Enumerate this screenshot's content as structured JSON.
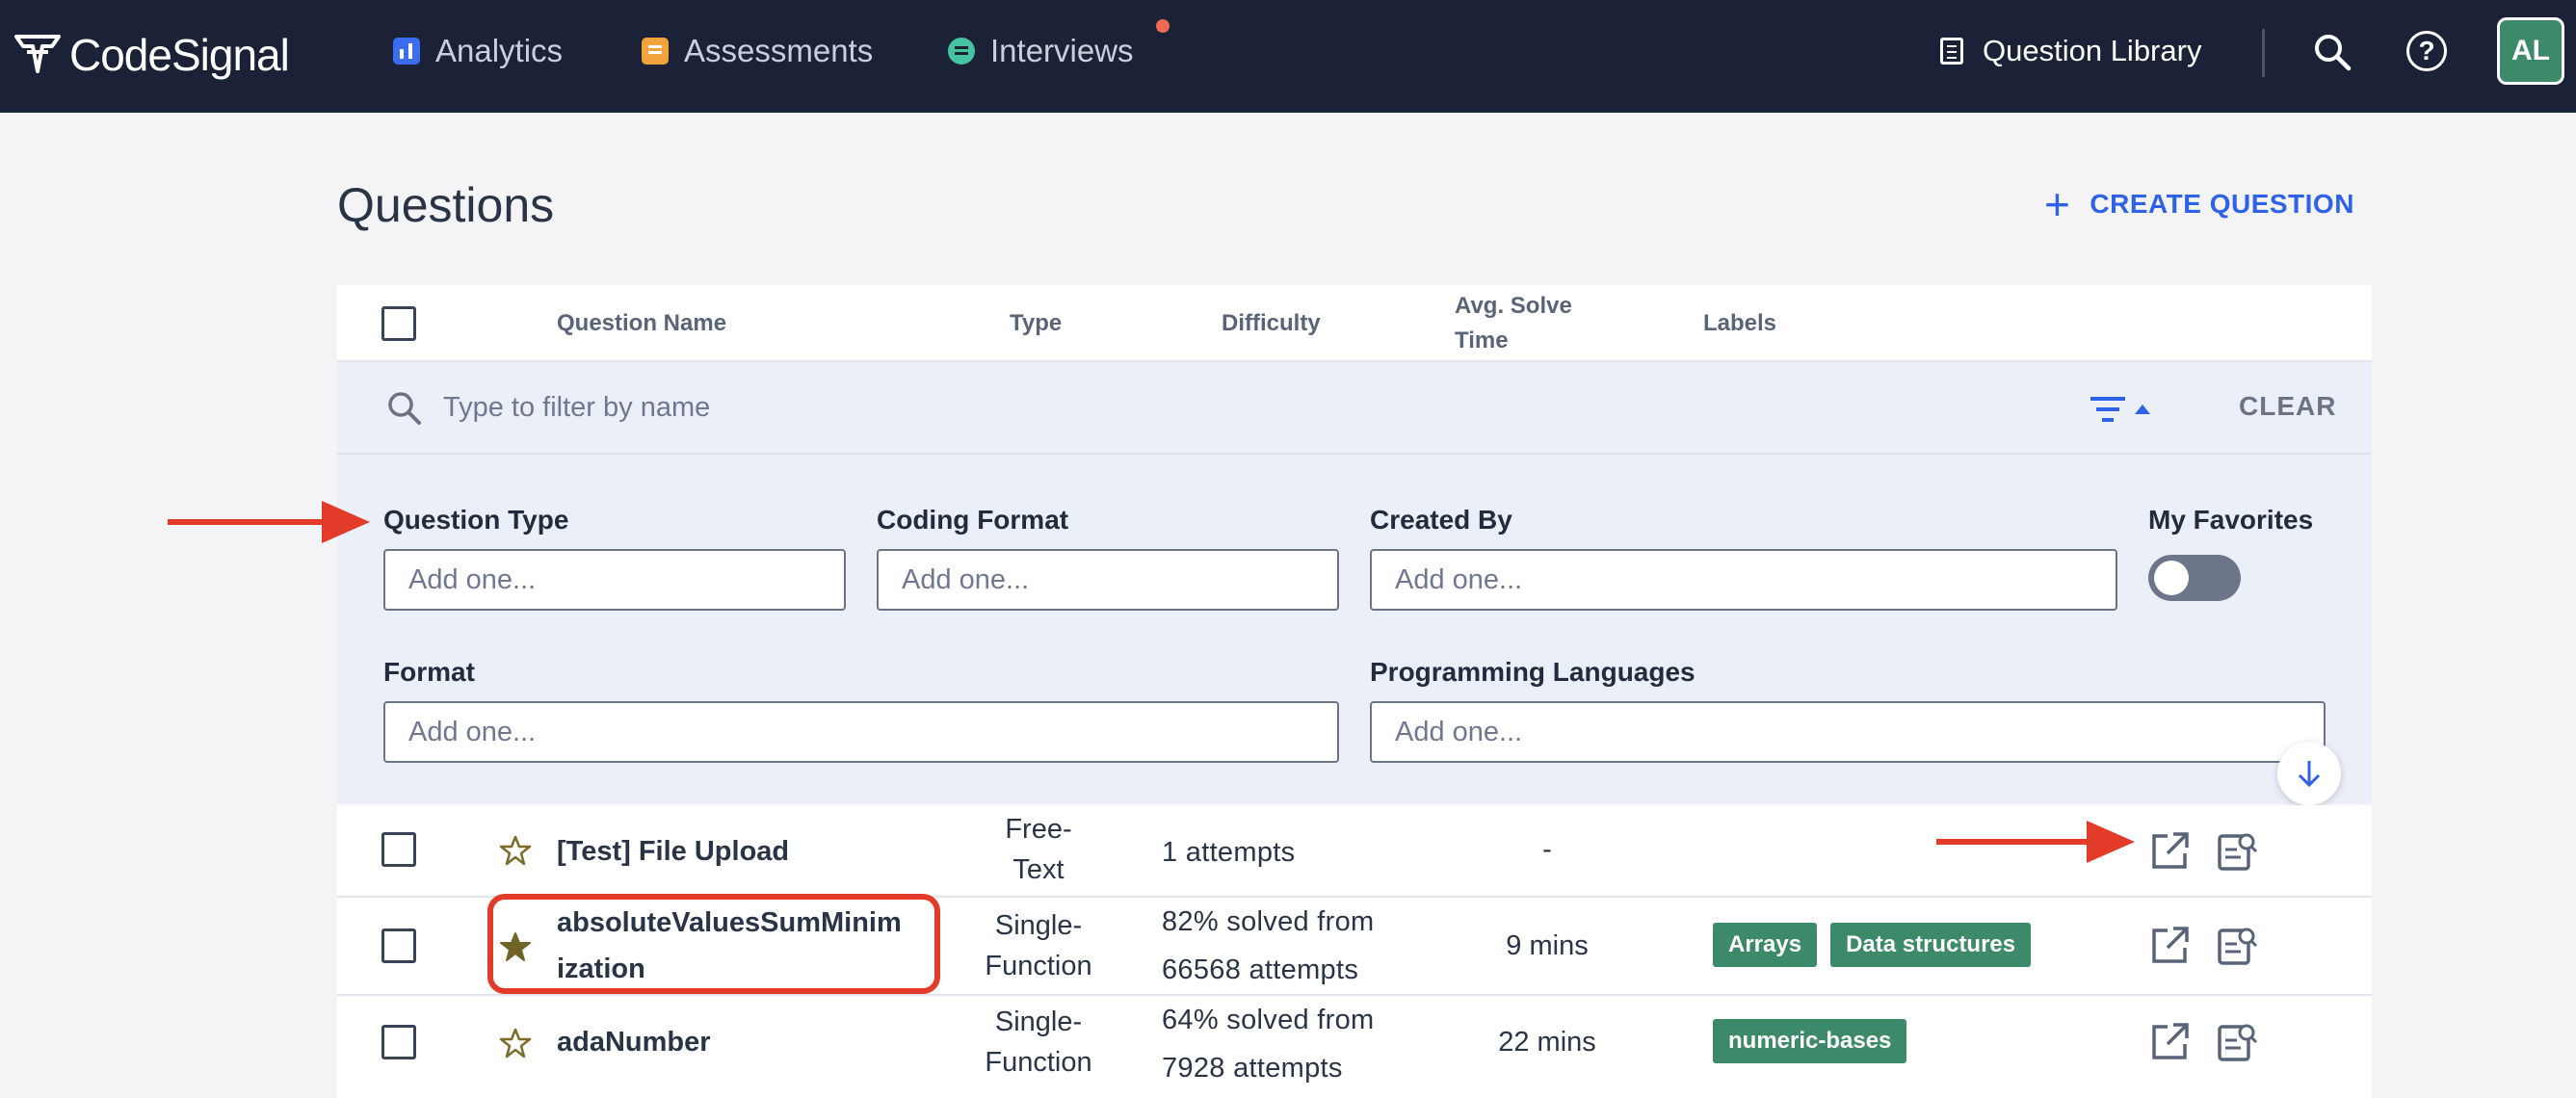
{
  "brand": {
    "name": "CodeSignal"
  },
  "nav": {
    "analytics": "Analytics",
    "assessments": "Assessments",
    "interviews": "Interviews",
    "question_library": "Question Library",
    "avatar_initials": "AL"
  },
  "page": {
    "title": "Questions",
    "create_label": "CREATE QUESTION"
  },
  "table_headers": {
    "name": "Question Name",
    "type": "Type",
    "difficulty": "Difficulty",
    "avg_solve_1": "Avg. Solve",
    "avg_solve_2": "Time",
    "labels": "Labels"
  },
  "filters": {
    "search_placeholder": "Type to filter by name",
    "clear_label": "CLEAR",
    "question_type_label": "Question Type",
    "coding_format_label": "Coding Format",
    "created_by_label": "Created By",
    "my_favorites_label": "My Favorites",
    "format_label": "Format",
    "programming_languages_label": "Programming Languages",
    "add_placeholder": "Add one...",
    "my_favorites_on": false
  },
  "rows": [
    {
      "name": "[Test] File Upload",
      "favorite": false,
      "type_1": "Free-",
      "type_2": "Text",
      "difficulty_1": "1 attempts",
      "difficulty_2": "",
      "avg_time": "-",
      "labels": []
    },
    {
      "name_1": "absoluteValuesSumMinim",
      "name_2": "ization",
      "favorite": true,
      "type_1": "Single-",
      "type_2": "Function",
      "difficulty_1": "82% solved from",
      "difficulty_2": "66568 attempts",
      "avg_time": "9 mins",
      "labels": [
        "Arrays",
        "Data structures"
      ]
    },
    {
      "name": "adaNumber",
      "favorite": false,
      "type_1": "Single-",
      "type_2": "Function",
      "difficulty_1": "64% solved from",
      "difficulty_2": "7928 attempts",
      "avg_time": "22 mins",
      "labels": [
        "numeric-bases"
      ]
    }
  ],
  "colors": {
    "topbar": "#1b2136",
    "accent": "#2e62e8",
    "tag": "#3d8a6a",
    "annotation": "#e33b2a"
  }
}
